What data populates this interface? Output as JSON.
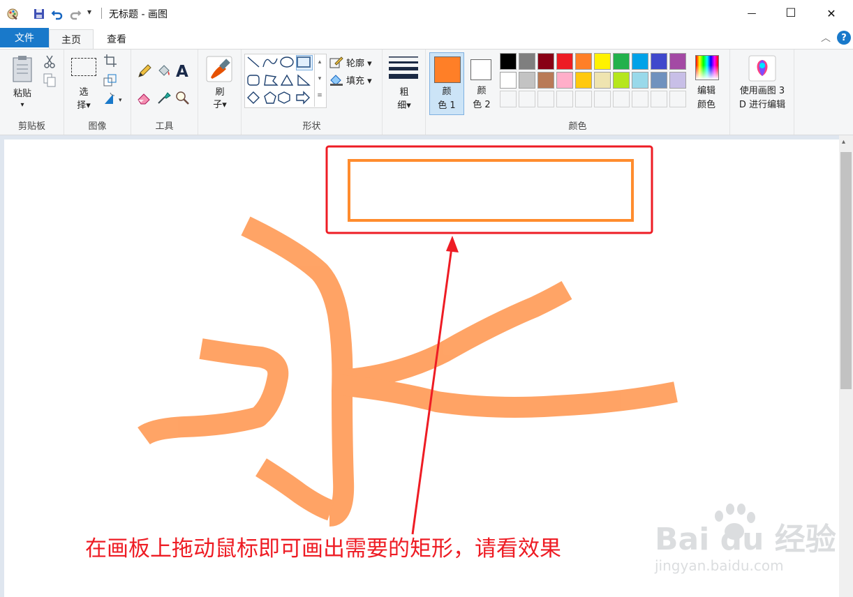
{
  "window": {
    "title": "无标题 - 画图",
    "qat_dropdown": "▾",
    "minimize": "—",
    "maximize": "☐",
    "close": "✕"
  },
  "menu": {
    "file": "文件",
    "tabs": [
      {
        "label": "主页",
        "active": true
      },
      {
        "label": "查看",
        "active": false
      }
    ],
    "collapse": "︿",
    "help": "?"
  },
  "ribbon": {
    "clipboard": {
      "paste": "粘贴",
      "group": "剪贴板"
    },
    "image": {
      "select_1": "选",
      "select_2": "择▾",
      "group": "图像"
    },
    "tools": {
      "text_glyph": "A",
      "group": "工具"
    },
    "brush": {
      "label_1": "刷",
      "label_2": "子▾"
    },
    "shapes": {
      "outline": "轮廓 ▾",
      "fill": "填充 ▾",
      "group": "形状"
    },
    "size": {
      "label_1": "粗",
      "label_2": "细▾"
    },
    "colors": {
      "color1_1": "颜",
      "color1_2": "色 1",
      "color2_1": "颜",
      "color2_2": "色 2",
      "color1_value": "#ff7f27",
      "color2_value": "#ffffff",
      "edit_1": "编辑",
      "edit_2": "颜色",
      "group": "颜色",
      "palette_row1": [
        "#000000",
        "#7f7f7f",
        "#880015",
        "#ed1c24",
        "#ff7f27",
        "#fff200",
        "#22b14c",
        "#00a2e8",
        "#3f48cc",
        "#a349a4"
      ],
      "palette_row2": [
        "#ffffff",
        "#c3c3c3",
        "#b97a57",
        "#ffaec9",
        "#ffc90e",
        "#efe4b0",
        "#b5e61d",
        "#99d9ea",
        "#7092be",
        "#c8bfe7"
      ]
    },
    "paint3d": {
      "label_1": "使用画图 3",
      "label_2": "D 进行编辑"
    }
  },
  "canvas": {
    "annotation": "在画板上拖动鼠标即可画出需要的矩形，请看效果",
    "watermark_text": "Bai du 经验",
    "watermark_url": "jingyan.baidu.com",
    "stroke_color": "#ff9a55",
    "rect_color": "#ff8c2e",
    "highlight_color": "#ee1c24"
  }
}
